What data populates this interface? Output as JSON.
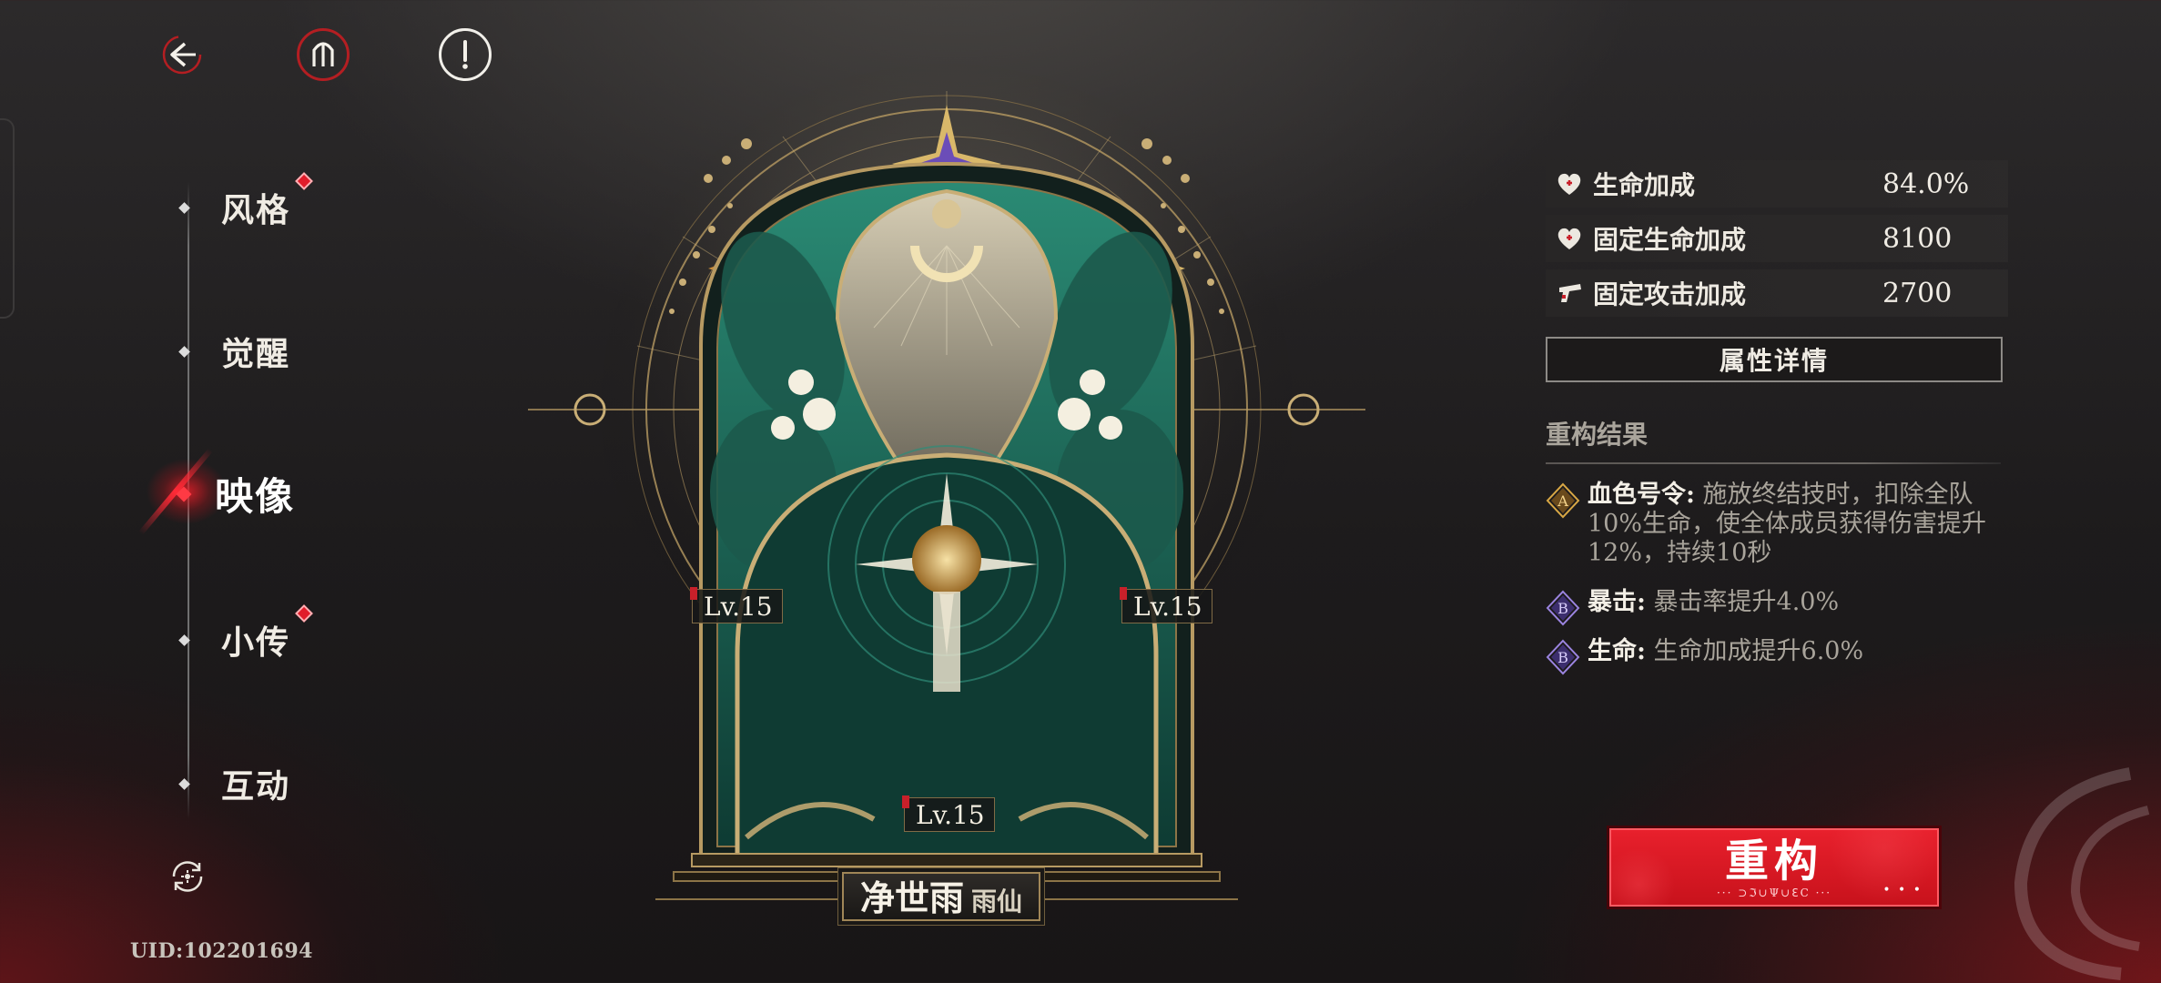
{
  "top_bar": {
    "back_icon": "back-arrow-icon",
    "archive_icon": "archive-portal-icon",
    "info_icon": "info-icon"
  },
  "nav": {
    "items": [
      {
        "label": "风格",
        "badge": true
      },
      {
        "label": "觉醒",
        "badge": false
      },
      {
        "label": "映像",
        "badge": false,
        "active": true
      },
      {
        "label": "小传",
        "badge": true
      },
      {
        "label": "互动",
        "badge": false
      }
    ]
  },
  "uid": "UID:102201694",
  "emblem": {
    "left_level": "Lv.15",
    "right_level": "Lv.15",
    "bottom_level": "Lv.15",
    "name": "净世雨",
    "subname": "雨仙",
    "colors": {
      "gold": "#c9a86a",
      "jade": "#1f6b5c",
      "purple": "#6a4fb3"
    }
  },
  "stats": [
    {
      "icon": "heart-plus-icon",
      "label": "生命加成",
      "value": "84.0%"
    },
    {
      "icon": "heart-plus-icon",
      "label": "固定生命加成",
      "value": "8100"
    },
    {
      "icon": "gun-icon",
      "label": "固定攻击加成",
      "value": "2700"
    }
  ],
  "detail_button": "属性详情",
  "rebuild_section": {
    "title": "重构结果",
    "effects": [
      {
        "grade": "A",
        "name": "血色号令:",
        "desc": " 施放终结技时，扣除全队10%生命，使全体成员获得伤害提升12%，持续10秒"
      },
      {
        "grade": "B",
        "name": "暴击:",
        "desc": " 暴击率提升4.0%"
      },
      {
        "grade": "B",
        "name": "生命:",
        "desc": " 生命加成提升6.0%"
      }
    ]
  },
  "rebuild_button": {
    "label": "重构",
    "sub": "··· ⊃ℑ∪Ψ∪ℇC ···",
    "dots": "• • •"
  },
  "colors": {
    "accent_red": "#e01c2a",
    "panel_bg": "#2a2828"
  }
}
